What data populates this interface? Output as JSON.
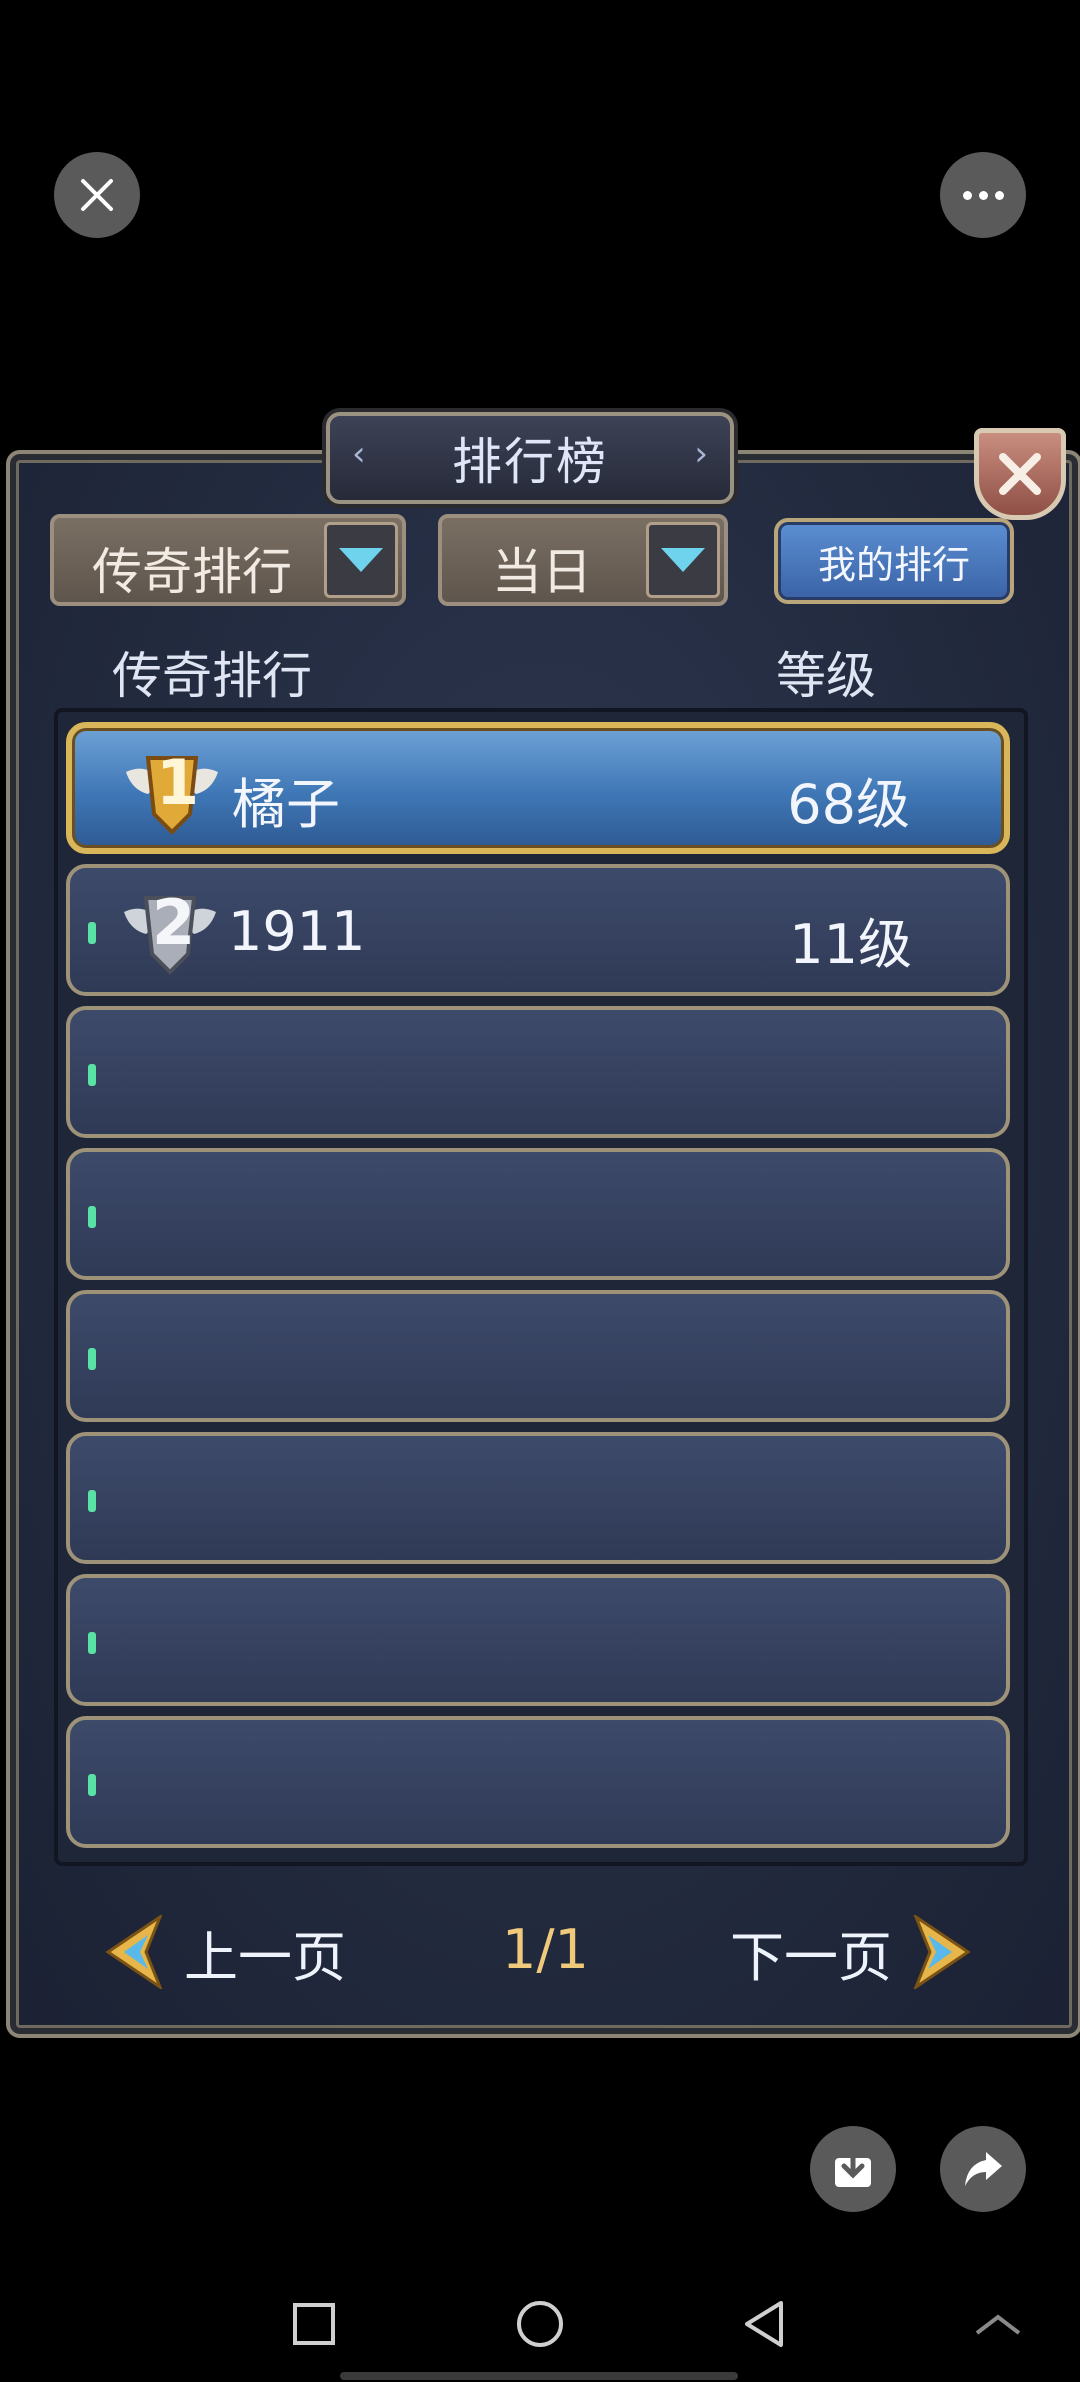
{
  "window": {
    "title": "排行榜"
  },
  "filters": {
    "category": "传奇排行",
    "period": "当日",
    "my_rank_label": "我的排行"
  },
  "columns": {
    "name": "传奇排行",
    "level": "等级"
  },
  "rows": [
    {
      "rank": "1",
      "name": "橘子",
      "level": "68级"
    },
    {
      "rank": "2",
      "name": "1911",
      "level": "11级"
    },
    {
      "rank": "",
      "name": "",
      "level": ""
    },
    {
      "rank": "",
      "name": "",
      "level": ""
    },
    {
      "rank": "",
      "name": "",
      "level": ""
    },
    {
      "rank": "",
      "name": "",
      "level": ""
    },
    {
      "rank": "",
      "name": "",
      "level": ""
    },
    {
      "rank": "",
      "name": "",
      "level": ""
    }
  ],
  "pagination": {
    "prev_label": "上一页",
    "next_label": "下一页",
    "page": "1/1"
  },
  "icons": {
    "close": "close-icon",
    "more": "more-icon",
    "download": "download-icon",
    "share": "share-icon"
  },
  "colors": {
    "accent_cyan": "#6fd3ee",
    "highlight_row": "#3f77b6",
    "gold_border": "#d9b65a",
    "page_number": "#f1c97a"
  }
}
